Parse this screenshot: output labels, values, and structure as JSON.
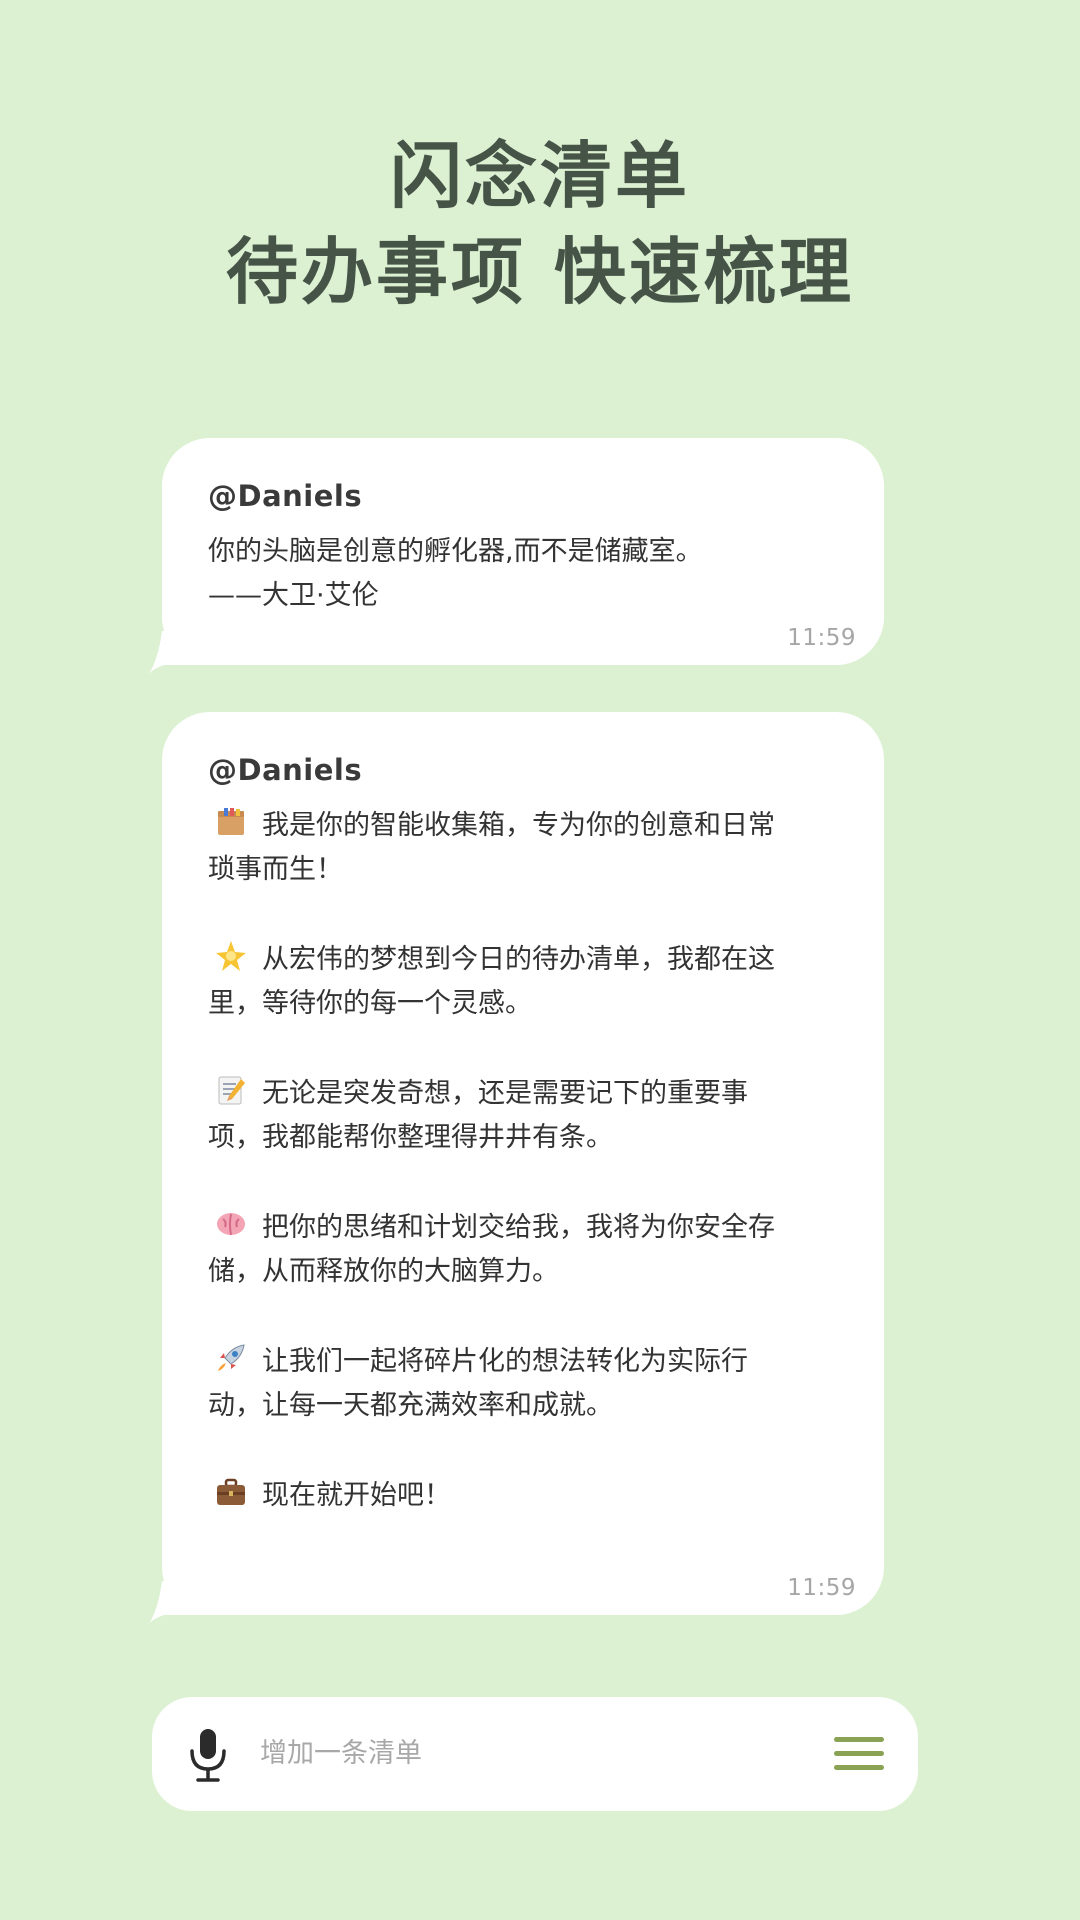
{
  "headline": {
    "line1": "闪念清单",
    "line2": "待办事项 快速梳理"
  },
  "messages": [
    {
      "sender": "@Daniels",
      "lines": [
        "你的头脑是创意的孵化器,而不是储藏室。",
        "——大卫·艾伦"
      ],
      "time": "11:59"
    },
    {
      "sender": "@Daniels",
      "paragraphs": [
        {
          "icon": "package-icon",
          "text": "我是你的智能收集箱，专为你的创意和日常\n琐事而生！"
        },
        {
          "icon": "sparkle-star-icon",
          "text": "从宏伟的梦想到今日的待办清单，我都在这\n里，等待你的每一个灵感。"
        },
        {
          "icon": "memo-icon",
          "text": "无论是突发奇想，还是需要记下的重要事\n项，我都能帮你整理得井井有条。"
        },
        {
          "icon": "brain-icon",
          "text": "把你的思绪和计划交给我，我将为你安全存\n储，从而释放你的大脑算力。"
        },
        {
          "icon": "rocket-icon",
          "text": "让我们一起将碎片化的想法转化为实际行\n动，让每一天都充满效率和成就。"
        },
        {
          "icon": "briefcase-icon",
          "text": "现在就开始吧！"
        }
      ],
      "time": "11:59"
    }
  ],
  "input": {
    "placeholder": "增加一条清单",
    "mic_icon": "microphone-icon",
    "menu_icon": "hamburger-menu-icon"
  },
  "colors": {
    "background": "#dcf1d2",
    "headline": "#465448",
    "menu_accent": "#8aa253"
  }
}
